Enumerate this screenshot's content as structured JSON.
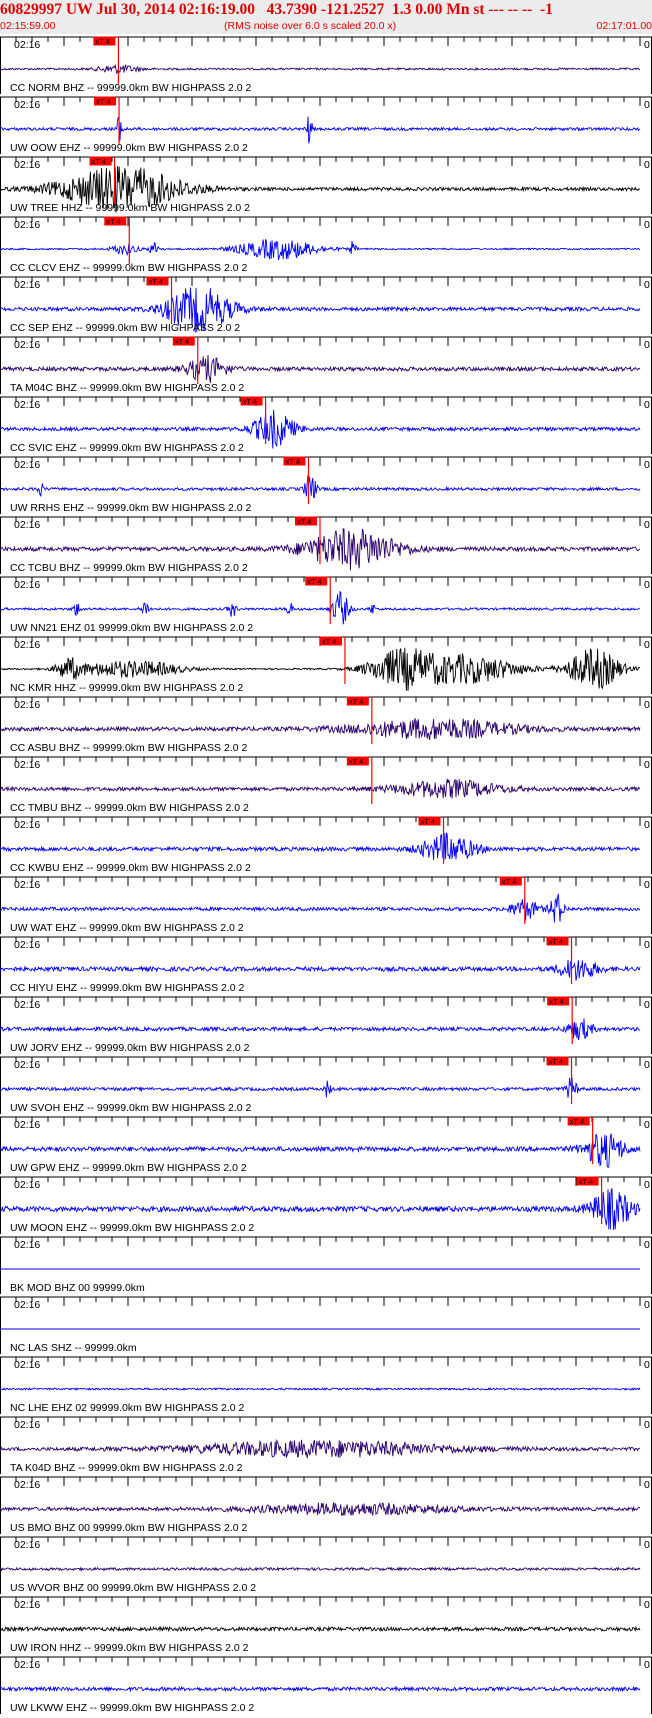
{
  "header": {
    "title": "60829997 UW Jul 30, 2014 02:16:19.00   43.7390 -121.2527  1.3 0.00 Mn st --- -- --  -1",
    "start_time": "02:15:59.00",
    "noise_note": "(RMS noise over 6.0 s scaled 20.0 x)",
    "end_time": "02:17:01.00"
  },
  "colors": {
    "blue": "#0000ff",
    "navy": "#2b006e",
    "black": "#000000",
    "pick": "#ff0000",
    "axis": "#000000",
    "header_bg": "#ececec",
    "header_text": "#e00000"
  },
  "chart_data": {
    "type": "seismogram",
    "x_start": "02:15:59.00",
    "x_end": "02:17:01.00",
    "tick_label": "02:16",
    "right_tick_label": "0",
    "pick_label": "xT 4",
    "traces": [
      {
        "label": "CC NORM BHZ -- 99999.0km BW  HIGHPASS  2.0  2",
        "color": "navy",
        "noise": 0.15,
        "pick": 18.5,
        "bursts": [
          {
            "t": 18.5,
            "a": 0.6,
            "w": 3
          }
        ]
      },
      {
        "label": "UW OOW EHZ -- 99999.0km BW  HIGHPASS  2.0  2",
        "color": "blue",
        "noise": 0.22,
        "pick": 18.6,
        "bursts": [
          {
            "t": 18.6,
            "a": 1.8,
            "w": 0.6
          },
          {
            "t": 48.3,
            "a": 2.5,
            "w": 0.4
          }
        ]
      },
      {
        "label": "UW TREE HHZ -- 99999.0km BW  HIGHPASS  2.0  2",
        "color": "black",
        "noise": 0.25,
        "pick": 17.9,
        "bursts": [
          {
            "t": 19,
            "a": 3.5,
            "w": 9
          }
        ]
      },
      {
        "label": "CC CLCV EHZ -- 99999.0km BW  HIGHPASS  2.0  2",
        "color": "blue",
        "noise": 0.12,
        "pick": 20.2,
        "bursts": [
          {
            "t": 19.5,
            "a": 0.8,
            "w": 2
          },
          {
            "t": 24.2,
            "a": 1.0,
            "w": 0.8
          },
          {
            "t": 43.5,
            "a": 1.6,
            "w": 6
          },
          {
            "t": 55.2,
            "a": 1.4,
            "w": 0.4
          }
        ]
      },
      {
        "label": "CC SEP EHZ -- 99999.0km BW  HIGHPASS  2.0  2",
        "color": "blue",
        "noise": 0.28,
        "pick": 26.8,
        "bursts": [
          {
            "t": 31,
            "a": 3.4,
            "w": 5
          }
        ]
      },
      {
        "label": "TA M04C BHZ -- 99999.0km BW  HIGHPASS  2.0  2",
        "color": "navy",
        "noise": 0.3,
        "pick": 30.9,
        "bursts": [
          {
            "t": 32.3,
            "a": 1.9,
            "w": 3
          }
        ]
      },
      {
        "label": "CC SVIC EHZ -- 99999.0km BW  HIGHPASS  2.0  2",
        "color": "blue",
        "noise": 0.26,
        "pick": 41.5,
        "bursts": [
          {
            "t": 42.8,
            "a": 2.8,
            "w": 3
          }
        ]
      },
      {
        "label": "UW RRHS EHZ -- 99999.0km BW  HIGHPASS  2.0  2",
        "color": "blue",
        "noise": 0.22,
        "pick": 48.2,
        "bursts": [
          {
            "t": 6.3,
            "a": 1.0,
            "w": 0.5
          },
          {
            "t": 48.5,
            "a": 2.6,
            "w": 0.8
          }
        ]
      },
      {
        "label": "CC TCBU BHZ -- 99999.0km BW  HIGHPASS  2.0  2",
        "color": "navy",
        "noise": 0.32,
        "pick": 50.0,
        "bursts": [
          {
            "t": 55,
            "a": 3.0,
            "w": 7
          }
        ]
      },
      {
        "label": "UW NN21 EHZ 01 99999.0km BW  HIGHPASS  2.0  2",
        "color": "blue",
        "noise": 0.18,
        "pick": 51.6,
        "bursts": [
          {
            "t": 12,
            "a": 1.0,
            "w": 0.6
          },
          {
            "t": 22.7,
            "a": 1.2,
            "w": 0.6
          },
          {
            "t": 36.3,
            "a": 1.2,
            "w": 0.6
          },
          {
            "t": 45.2,
            "a": 1.1,
            "w": 0.5
          },
          {
            "t": 53.2,
            "a": 2.8,
            "w": 1.2
          },
          {
            "t": 58.2,
            "a": 0.9,
            "w": 0.4
          }
        ]
      },
      {
        "label": "NC KMR HHZ -- 99999.0km BW  HIGHPASS  2.0  2",
        "color": "black",
        "noise": 0.12,
        "pick": 53.9,
        "bursts": [
          {
            "t": 10.8,
            "a": 1.6,
            "w": 2
          },
          {
            "t": 17.3,
            "a": 1.0,
            "w": 5
          },
          {
            "t": 24,
            "a": 0.9,
            "w": 5
          },
          {
            "t": 62.7,
            "a": 2.8,
            "w": 5
          },
          {
            "t": 72.8,
            "a": 2.2,
            "w": 8
          },
          {
            "t": 92.8,
            "a": 3.2,
            "w": 4
          }
        ]
      },
      {
        "label": "CC ASBU BHZ -- 99999.0km BW  HIGHPASS  2.0  2",
        "color": "navy",
        "noise": 0.3,
        "pick": 58.1,
        "bursts": [
          {
            "t": 68,
            "a": 1.5,
            "w": 12
          }
        ]
      },
      {
        "label": "CC TMBU BHZ -- 99999.0km BW  HIGHPASS  2.0  2",
        "color": "navy",
        "noise": 0.28,
        "pick": 58.1,
        "bursts": [
          {
            "t": 70,
            "a": 1.3,
            "w": 8
          }
        ]
      },
      {
        "label": "CC KWBU EHZ -- 99999.0km BW  HIGHPASS  2.0  2",
        "color": "blue",
        "noise": 0.3,
        "pick": 69.3,
        "bursts": [
          {
            "t": 70,
            "a": 2.2,
            "w": 4
          }
        ]
      },
      {
        "label": "UW WAT EHZ -- 99999.0km BW  HIGHPASS  2.0  2",
        "color": "blue",
        "noise": 0.26,
        "pick": 82.0,
        "bursts": [
          {
            "t": 82,
            "a": 1.6,
            "w": 2
          },
          {
            "t": 87,
            "a": 2.4,
            "w": 1
          }
        ]
      },
      {
        "label": "CC HIYU EHZ -- 99999.0km BW  HIGHPASS  2.0  2",
        "color": "blue",
        "noise": 0.32,
        "pick": 89.3,
        "bursts": [
          {
            "t": 90.3,
            "a": 1.6,
            "w": 3
          }
        ]
      },
      {
        "label": "UW JORV EHZ -- 99999.0km BW  HIGHPASS  2.0  2",
        "color": "blue",
        "noise": 0.28,
        "pick": 89.4,
        "bursts": [
          {
            "t": 90.6,
            "a": 1.6,
            "w": 1.8
          }
        ]
      },
      {
        "label": "UW SVOH EHZ -- 99999.0km BW  HIGHPASS  2.0  2",
        "color": "blue",
        "noise": 0.24,
        "pick": 89.3,
        "bursts": [
          {
            "t": 51.2,
            "a": 1.4,
            "w": 0.4
          },
          {
            "t": 89.3,
            "a": 1.8,
            "w": 0.8
          }
        ]
      },
      {
        "label": "UW GPW EHZ -- 99999.0km BW  HIGHPASS  2.0  2",
        "color": "blue",
        "noise": 0.34,
        "pick": 92.6,
        "bursts": [
          {
            "t": 94.4,
            "a": 2.6,
            "w": 3
          }
        ]
      },
      {
        "label": "UW MOON EHZ -- 99999.0km BW  HIGHPASS  2.0  2",
        "color": "blue",
        "noise": 0.4,
        "pick": 94.0,
        "bursts": [
          {
            "t": 95.5,
            "a": 3.0,
            "w": 3
          }
        ]
      },
      {
        "label": "BK MOD BHZ 00 99999.0km",
        "color": "blue",
        "noise": 0,
        "pick": null,
        "bursts": []
      },
      {
        "label": "NC LAS SHZ -- 99999.0km",
        "color": "blue",
        "noise": 0,
        "pick": null,
        "bursts": []
      },
      {
        "label": "NC LHE EHZ 02 99999.0km BW  HIGHPASS  2.0  2",
        "color": "blue",
        "noise": 0.14,
        "pick": null,
        "bursts": []
      },
      {
        "label": "TA K04D BHZ -- 99999.0km BW  HIGHPASS  2.0  2",
        "color": "navy",
        "noise": 0.25,
        "pick": null,
        "bursts": [
          {
            "t": 50,
            "a": 1.2,
            "w": 20
          }
        ]
      },
      {
        "label": "US BMO BHZ 00 99999.0km BW  HIGHPASS  2.0  2",
        "color": "navy",
        "noise": 0.26,
        "pick": null,
        "bursts": [
          {
            "t": 55,
            "a": 0.8,
            "w": 15
          }
        ]
      },
      {
        "label": "US WVOR BHZ 00 99999.0km BW  HIGHPASS  2.0  2",
        "color": "navy",
        "noise": 0.2,
        "pick": null,
        "bursts": []
      },
      {
        "label": "UW IRON HHZ -- 99999.0km BW  HIGHPASS  2.0  2",
        "color": "black",
        "noise": 0.28,
        "pick": null,
        "bursts": []
      },
      {
        "label": "UW LKWW EHZ -- 99999.0km BW  HIGHPASS  2.0  2",
        "color": "blue",
        "noise": 0.28,
        "pick": null,
        "bursts": []
      }
    ]
  }
}
